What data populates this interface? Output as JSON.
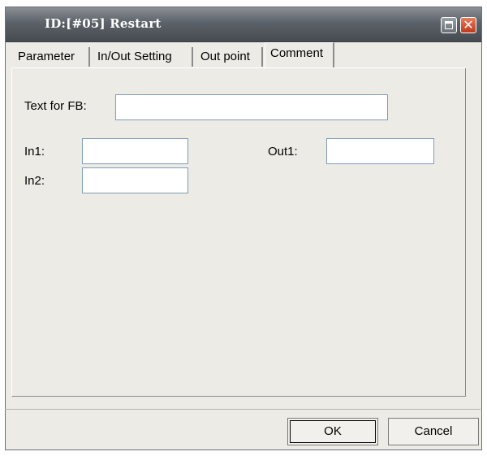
{
  "window": {
    "title": "ID:[#05] Restart"
  },
  "titlebar_buttons": {
    "maximize_icon": "maximize-icon",
    "close_icon": "close-icon",
    "close_glyph": "✕"
  },
  "tabs": [
    {
      "label": "Parameter",
      "active": false
    },
    {
      "label": "In/Out Setting",
      "active": false
    },
    {
      "label": "Out point",
      "active": false
    },
    {
      "label": "Comment",
      "active": true
    }
  ],
  "form": {
    "text_for_fb": {
      "label": "Text for FB:",
      "value": ""
    },
    "in1": {
      "label": "In1:",
      "value": ""
    },
    "in2": {
      "label": "In2:",
      "value": ""
    },
    "out1": {
      "label": "Out1:",
      "value": ""
    }
  },
  "buttons": {
    "ok": "OK",
    "cancel": "Cancel"
  },
  "colors": {
    "titlebar": "#5c6269",
    "window_bg": "#ecebe6",
    "close": "#c0391b"
  }
}
